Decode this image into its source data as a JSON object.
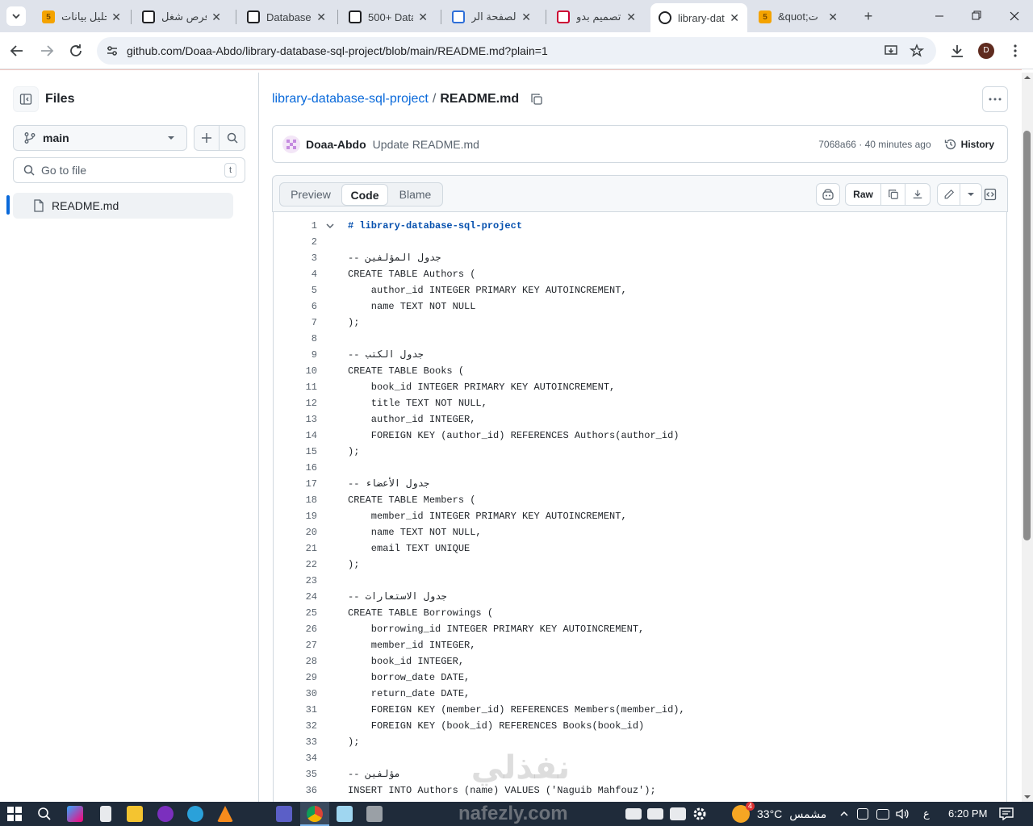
{
  "browser": {
    "tabs": [
      {
        "title": "تحليل بيانات",
        "favicon_text": "5"
      },
      {
        "title": "فرص شغل",
        "favicon_text": ""
      },
      {
        "title": "Database",
        "favicon_text": ""
      },
      {
        "title": "500+ Data",
        "favicon_text": ""
      },
      {
        "title": "الصفحة الر",
        "favicon_text": ""
      },
      {
        "title": "تصميم بدو",
        "favicon_text": ""
      },
      {
        "title": "library-dat",
        "favicon_text": ""
      },
      {
        "title": "&quot;ت",
        "favicon_text": "5"
      }
    ],
    "url": "github.com/Doaa-Abdo/library-database-sql-project/blob/main/README.md?plain=1",
    "profile_initial": "D"
  },
  "sidebar": {
    "title": "Files",
    "branch": "main",
    "search_placeholder": "Go to file",
    "search_shortcut": "t",
    "files": [
      {
        "name": "README.md"
      }
    ]
  },
  "breadcrumb": {
    "repo": "library-database-sql-project",
    "separator": "/",
    "file": "README.md"
  },
  "commit": {
    "author": "Doaa-Abdo",
    "message": "Update README.md",
    "sha_time": "7068a66 · 40 minutes ago",
    "history_label": "History"
  },
  "file_toolbar": {
    "tabs": [
      "Preview",
      "Code",
      "Blame"
    ],
    "raw_label": "Raw"
  },
  "code_lines": [
    "# library-database-sql-project",
    "",
    "-- جدول المؤلفين",
    "CREATE TABLE Authors (",
    "    author_id INTEGER PRIMARY KEY AUTOINCREMENT,",
    "    name TEXT NOT NULL",
    ");",
    "",
    "-- جدول الكتب",
    "CREATE TABLE Books (",
    "    book_id INTEGER PRIMARY KEY AUTOINCREMENT,",
    "    title TEXT NOT NULL,",
    "    author_id INTEGER,",
    "    FOREIGN KEY (author_id) REFERENCES Authors(author_id)",
    ");",
    "",
    "-- جدول الأعضاء",
    "CREATE TABLE Members (",
    "    member_id INTEGER PRIMARY KEY AUTOINCREMENT,",
    "    name TEXT NOT NULL,",
    "    email TEXT UNIQUE",
    ");",
    "",
    "-- جدول الاستعارات",
    "CREATE TABLE Borrowings (",
    "    borrowing_id INTEGER PRIMARY KEY AUTOINCREMENT,",
    "    member_id INTEGER,",
    "    book_id INTEGER,",
    "    borrow_date DATE,",
    "    return_date DATE,",
    "    FOREIGN KEY (member_id) REFERENCES Members(member_id),",
    "    FOREIGN KEY (book_id) REFERENCES Books(book_id)",
    ");",
    "",
    "-- مؤلفين",
    "INSERT INTO Authors (name) VALUES ('Naguib Mahfouz');"
  ],
  "taskbar": {
    "weather_temp": "33°C",
    "weather_label": "مشمس",
    "notif_count": "4",
    "lang": "ع",
    "time": "6:20 PM"
  },
  "watermark": {
    "text": "nafezly.com",
    "arabic": "نفذلي"
  },
  "colors": {
    "accent": "#0969da",
    "heading_code": "#0550ae",
    "taskbar": "#1f2b3a"
  }
}
